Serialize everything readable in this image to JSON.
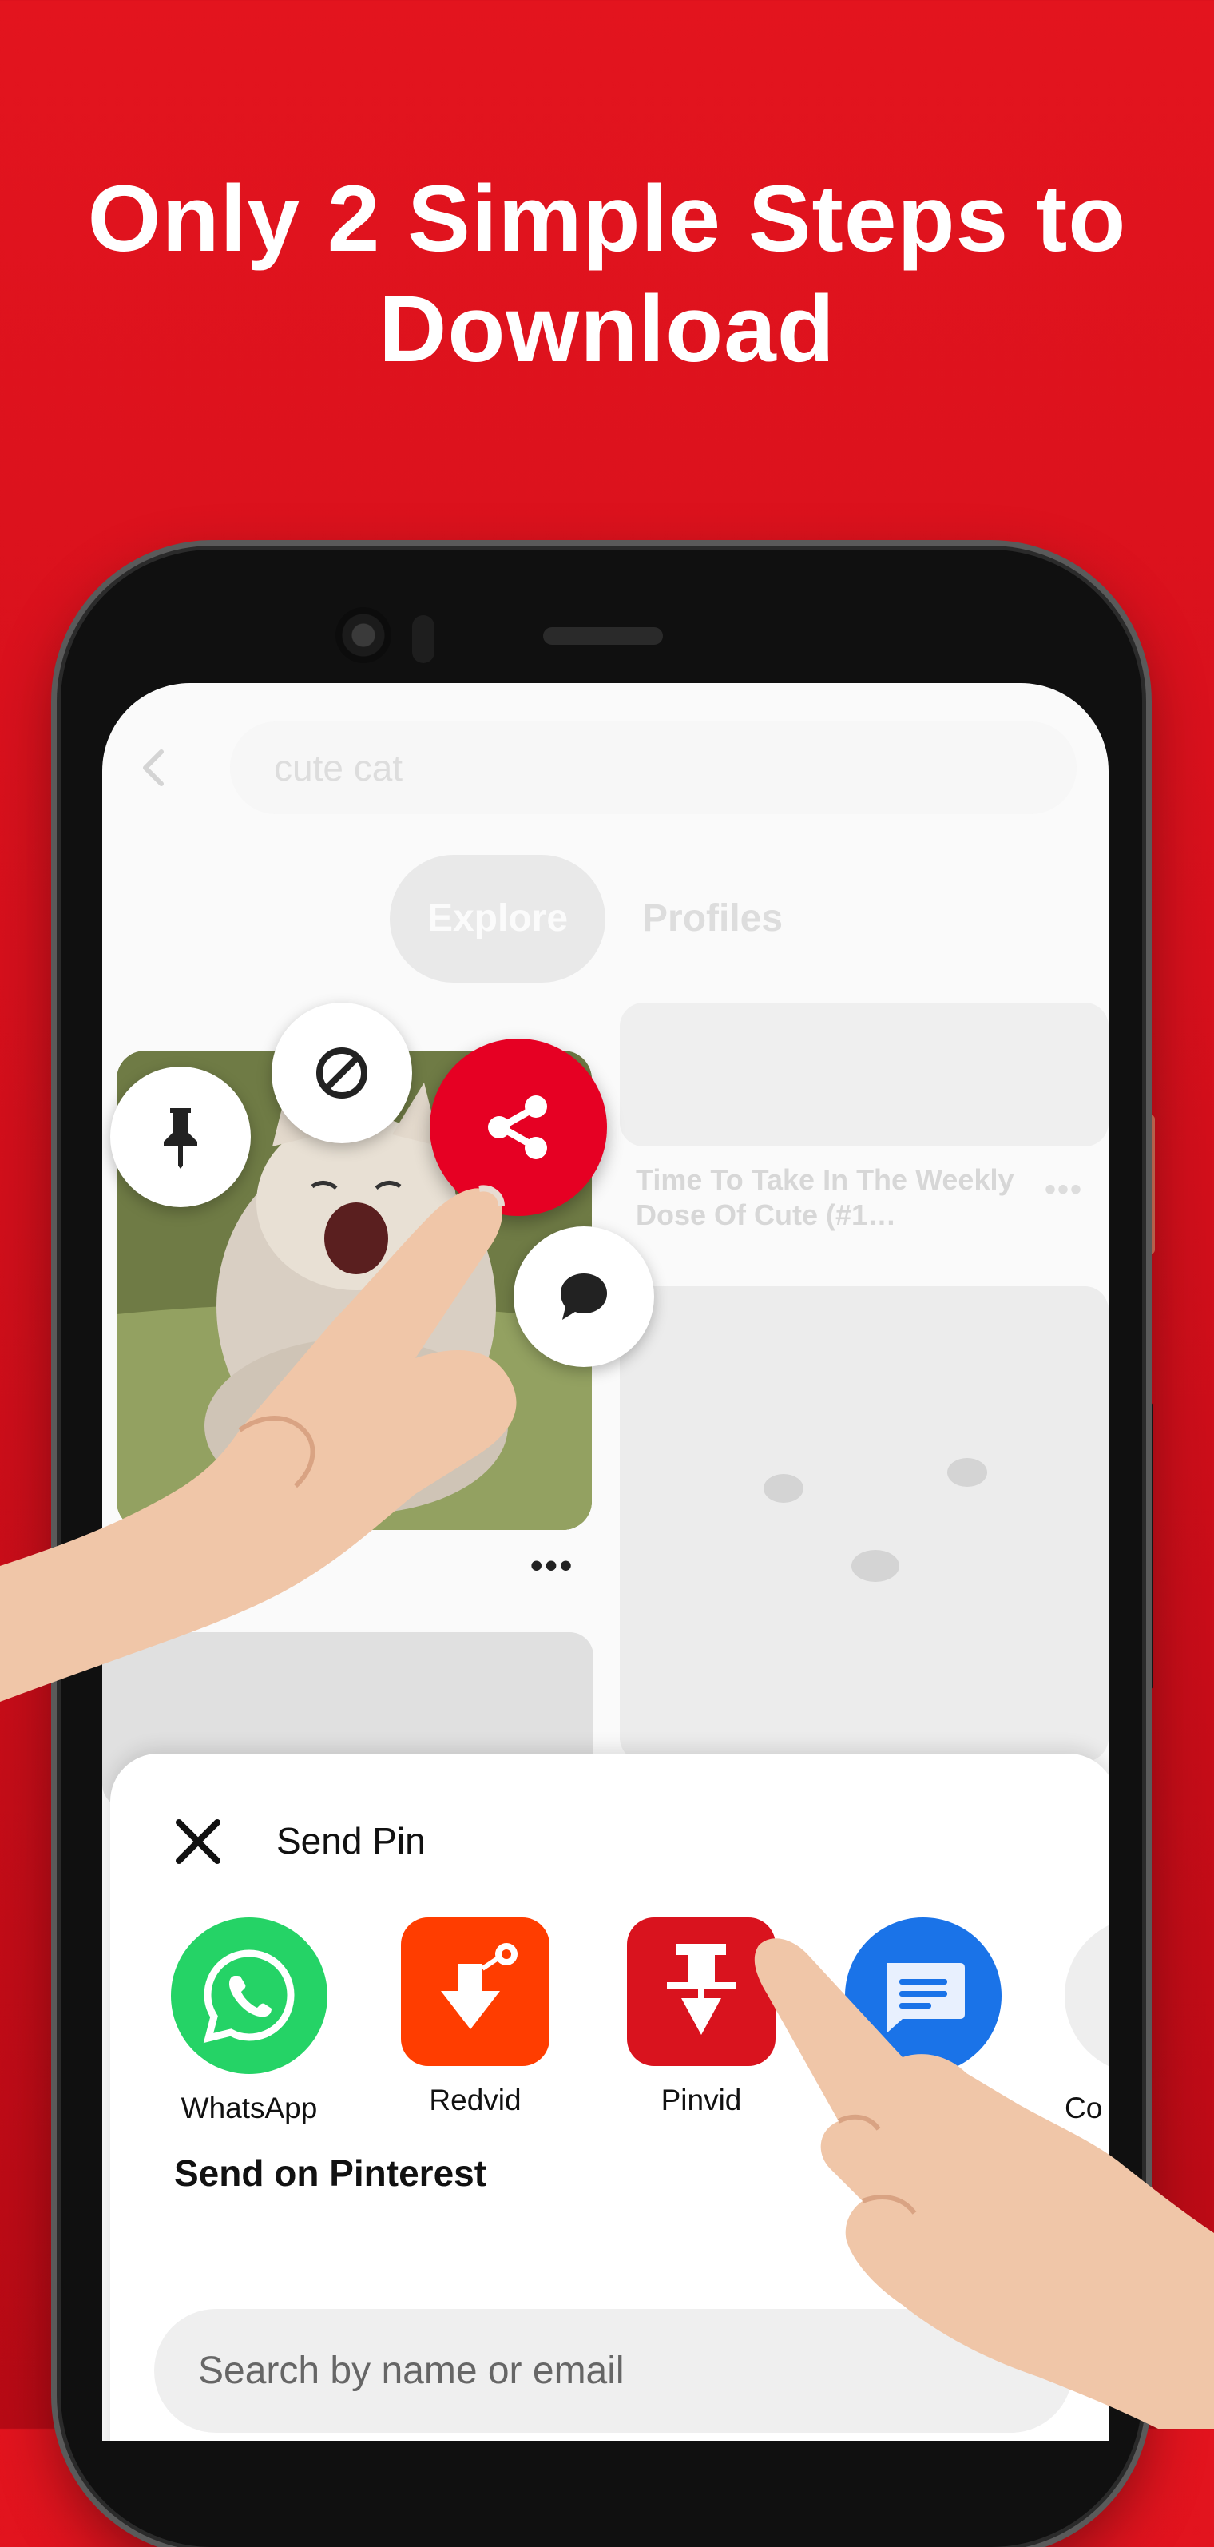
{
  "headline": {
    "line1": "Only 2 Simple Steps to",
    "line2": "Download"
  },
  "background_screen": {
    "search_query": "cute cat",
    "tabs": [
      {
        "label": "Explore",
        "active": true
      },
      {
        "label": "Profiles",
        "active": false
      }
    ],
    "pin_title": "Time To Take In The Weekly Dose Of Cute (#1…",
    "more_label": "•••"
  },
  "pin_actions": {
    "icons": [
      "pin-icon",
      "hide-icon",
      "share-icon",
      "comment-icon"
    ],
    "share_color": "#e60023"
  },
  "send_sheet": {
    "title": "Send Pin",
    "apps": [
      {
        "label": "WhatsApp",
        "icon": "whatsapp-icon",
        "color": "#25d366"
      },
      {
        "label": "Redvid",
        "icon": "redvid-icon",
        "color": "#ff3d00"
      },
      {
        "label": "Pinvid",
        "icon": "pinvid-icon",
        "color": "#d9131e"
      },
      {
        "label": "",
        "icon": "messages-icon",
        "color": "#1a73e8"
      },
      {
        "label": "Co",
        "icon": "copy-link-icon",
        "color": "#eeeeee"
      }
    ],
    "subtitle": "Send on Pinterest",
    "search_placeholder": "Search by name or email"
  }
}
